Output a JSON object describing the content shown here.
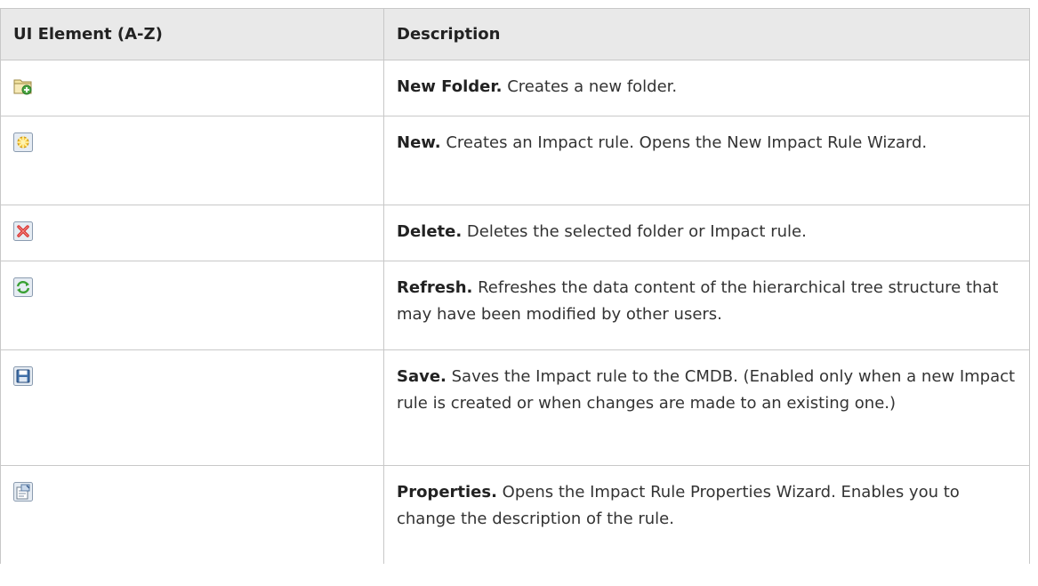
{
  "table": {
    "headers": [
      "UI Element (A-Z)",
      "Description"
    ],
    "rows": [
      {
        "icon": "new-folder-icon",
        "term": "New Folder.",
        "text": " Creates a new folder."
      },
      {
        "icon": "new-icon",
        "term": "New.",
        "text": " Creates an Impact rule. Opens the New Impact Rule Wizard."
      },
      {
        "icon": "delete-icon",
        "term": "Delete.",
        "text": " Deletes the selected folder or Impact rule."
      },
      {
        "icon": "refresh-icon",
        "term": "Refresh.",
        "text": " Refreshes the data content of the hierarchical tree structure that may have been modified by other users."
      },
      {
        "icon": "save-icon",
        "term": "Save.",
        "text": " Saves the Impact rule to the CMDB. (Enabled only when a new Impact rule is created or when changes are made to an existing one.)"
      },
      {
        "icon": "properties-icon",
        "term": "Properties.",
        "text": " Opens the Impact Rule Properties Wizard. Enables you to change the description of the rule."
      }
    ]
  },
  "colors": {
    "header_bg": "#e9e9e9",
    "border": "#c8c8c8",
    "text": "#333333"
  }
}
